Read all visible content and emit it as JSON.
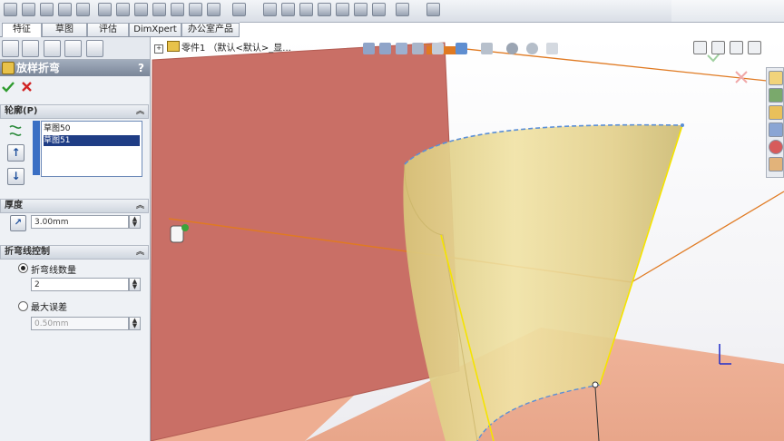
{
  "tabs": [
    {
      "label": "特征"
    },
    {
      "label": "草图"
    },
    {
      "label": "评估"
    },
    {
      "label": "DimXpert"
    },
    {
      "label": "办公室产品"
    }
  ],
  "feature_manager": {
    "title": "放样折弯",
    "help": "?"
  },
  "sections": {
    "profiles": {
      "title": "轮廓(P)",
      "items": [
        "草图50",
        "草图51"
      ]
    },
    "thickness": {
      "title": "厚度",
      "value": "3.00mm"
    },
    "bend_control": {
      "title": "折弯线控制",
      "opt1_label": "折弯线数量",
      "opt1_value": "2",
      "opt2_label": "最大误差",
      "opt2_value": "0.50mm"
    }
  },
  "tree": {
    "part_label": "零件1 （默认<默认>_显..."
  },
  "colors": {
    "plane": "#c96f66",
    "surface": "#e8d78a",
    "accent_orange": "#e07a22",
    "ok_green": "#2e9b2e",
    "cancel_red": "#d12424"
  },
  "icons": {
    "ok": "check-icon",
    "cancel": "x-icon"
  }
}
